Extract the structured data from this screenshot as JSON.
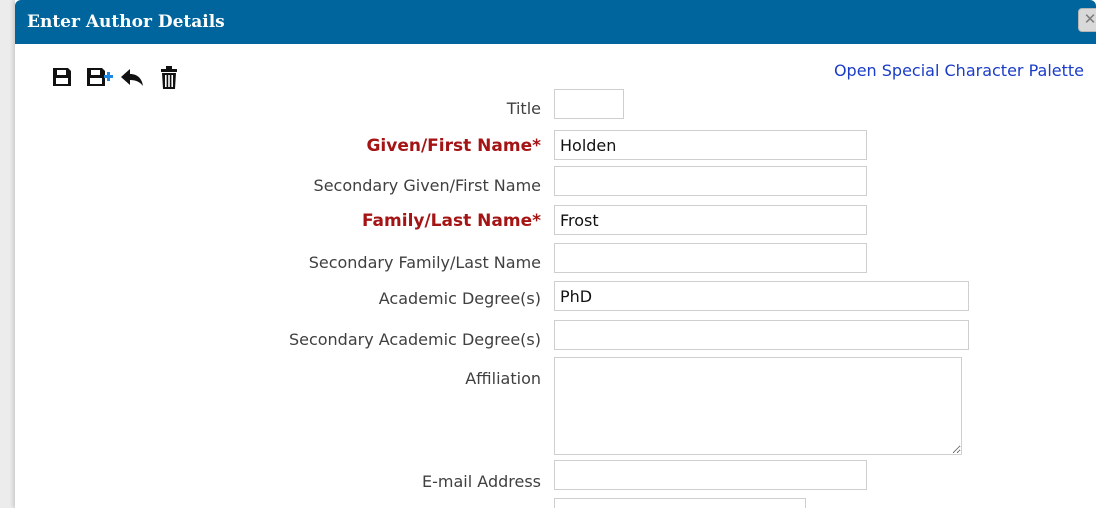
{
  "dialog": {
    "title": "Enter Author Details",
    "close_label": "✕",
    "palette_link": "Open Special Character Palette"
  },
  "toolbar": {
    "icons": [
      "save-icon",
      "save-and-add-icon",
      "undo-icon",
      "delete-icon"
    ]
  },
  "form": {
    "title_label": "Title",
    "title_value": "",
    "given_name_label": "Given/First Name*",
    "given_name_value": "Holden",
    "secondary_given_label": "Secondary Given/First Name",
    "secondary_given_value": "",
    "family_name_label": "Family/Last Name*",
    "family_name_value": "Frost",
    "secondary_family_label": "Secondary Family/Last Name",
    "secondary_family_value": "",
    "degree_label": "Academic Degree(s)",
    "degree_value": "PhD",
    "secondary_degree_label": "Secondary Academic Degree(s)",
    "secondary_degree_value": "",
    "affiliation_label": "Affiliation",
    "affiliation_value": "",
    "email_label": "E-mail Address",
    "email_value": ""
  },
  "colors": {
    "titlebar": "#00659c",
    "required_label": "#a41414",
    "link": "#1a3cc7"
  }
}
